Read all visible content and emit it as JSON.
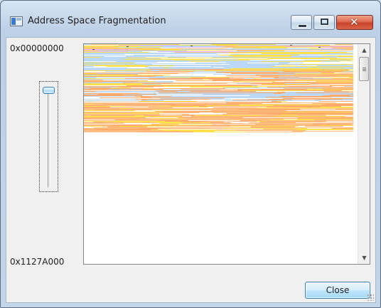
{
  "window": {
    "title": "Address Space Fragmentation",
    "icon": "app-window-icon",
    "controls": [
      "minimize-icon",
      "maximize-icon",
      "close-icon"
    ]
  },
  "labels": {
    "top_address": "0x00000000",
    "bottom_address": "0x1127A000"
  },
  "slider": {
    "position_fraction": 0.0
  },
  "colors": {
    "free": "#ffffff",
    "reserved": "#bcd8f7",
    "image": "#ffa96b",
    "mapped": "#ffbf80",
    "private": "#ffe14f",
    "other": "#e6b4f0",
    "dark": "#505050"
  },
  "scrollbar": {
    "position_fraction": 0.0
  },
  "buttons": {
    "close_label": "Close"
  }
}
